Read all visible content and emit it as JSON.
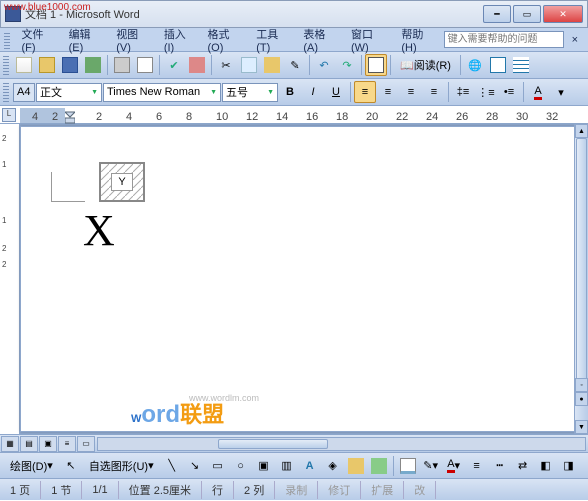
{
  "watermark": "www.blue1000.com",
  "title": "文档 1 - Microsoft Word",
  "menu": {
    "file": "文件(F)",
    "edit": "编辑(E)",
    "view": "视图(V)",
    "insert": "插入(I)",
    "format": "格式(O)",
    "tools": "工具(T)",
    "table": "表格(A)",
    "window": "窗口(W)",
    "help": "帮助(H)"
  },
  "help_box_placeholder": "键入需要帮助的问题",
  "format_bar": {
    "style_combo": "A4",
    "stylename": "正文",
    "font": "Times New Roman",
    "size": "五号",
    "read_label": "阅读(R)"
  },
  "ruler": {
    "L": "L",
    "nums": [
      "4",
      "2",
      "2",
      "4",
      "6",
      "8",
      "10",
      "12",
      "14",
      "16",
      "18",
      "20",
      "22",
      "24",
      "26",
      "28",
      "30",
      "32"
    ]
  },
  "vruler_nums": [
    "2",
    "1",
    "1",
    "2",
    "2"
  ],
  "document": {
    "field_text": "Y",
    "big_letter": "X"
  },
  "logo": {
    "url": "www.wordlm.com",
    "brand_en": "Word",
    "brand_cn": "联盟"
  },
  "drawbar": {
    "draw_label": "绘图(D)",
    "autoshape_label": "自选图形(U)"
  },
  "status": {
    "page": "1 页",
    "sec": "1 节",
    "pages": "1/1",
    "pos": "位置 2.5厘米",
    "line": "行",
    "col": "2 列",
    "rec": "录制",
    "rev": "修订",
    "ext": "扩展",
    "ovr": "改"
  }
}
